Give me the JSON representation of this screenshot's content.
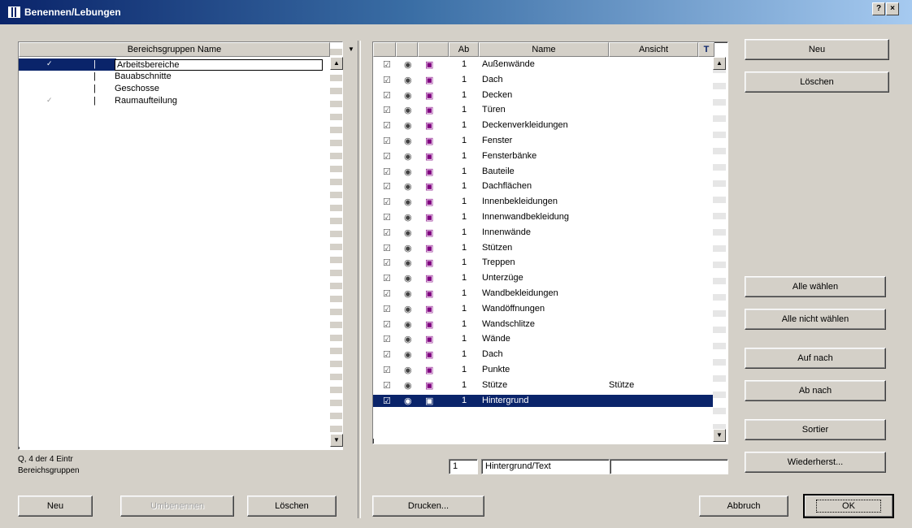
{
  "window": {
    "title": "Benennen/Lebungen",
    "close_glyph": "×",
    "help_glyph": "?"
  },
  "left_panel": {
    "column_header": "Bereichsgruppen Name",
    "rows": [
      {
        "mark": "✓",
        "sep": "|",
        "name": "Arbeitsbereiche"
      },
      {
        "mark": "",
        "sep": "|",
        "name": "Bauabschnitte"
      },
      {
        "mark": "",
        "sep": "|",
        "name": "Geschosse"
      },
      {
        "mark": "✓",
        "sep": "|",
        "name": "Raumaufteilung"
      }
    ],
    "status_line1": "Q, 4 der 4 Eintr",
    "status_line2": "Bereichsgruppen"
  },
  "middle_panel": {
    "headers": [
      "",
      "",
      "",
      "Ab",
      "Name",
      "Ansicht",
      "T"
    ],
    "rows": [
      {
        "c1": "☑",
        "c2": "◉",
        "c3": "▣",
        "count": "1",
        "name": "Außenwände",
        "extra": ""
      },
      {
        "c1": "☑",
        "c2": "◉",
        "c3": "▣",
        "count": "1",
        "name": "Dach",
        "extra": ""
      },
      {
        "c1": "☑",
        "c2": "◉",
        "c3": "▣",
        "count": "1",
        "name": "Decken",
        "extra": ""
      },
      {
        "c1": "☑",
        "c2": "◉",
        "c3": "▣",
        "count": "1",
        "name": "Türen",
        "extra": ""
      },
      {
        "c1": "☑",
        "c2": "◉",
        "c3": "▣",
        "count": "1",
        "name": "Deckenverkleidungen",
        "extra": ""
      },
      {
        "c1": "☑",
        "c2": "◉",
        "c3": "▣",
        "count": "1",
        "name": "Fenster",
        "extra": ""
      },
      {
        "c1": "☑",
        "c2": "◉",
        "c3": "▣",
        "count": "1",
        "name": "Fensterbänke",
        "extra": ""
      },
      {
        "c1": "☑",
        "c2": "◉",
        "c3": "▣",
        "count": "1",
        "name": "Bauteile",
        "extra": ""
      },
      {
        "c1": "☑",
        "c2": "◉",
        "c3": "▣",
        "count": "1",
        "name": "Dachflächen",
        "extra": ""
      },
      {
        "c1": "☑",
        "c2": "◉",
        "c3": "▣",
        "count": "1",
        "name": "Innenbekleidungen",
        "extra": ""
      },
      {
        "c1": "☑",
        "c2": "◉",
        "c3": "▣",
        "count": "1",
        "name": "Innenwandbekleidung",
        "extra": ""
      },
      {
        "c1": "☑",
        "c2": "◉",
        "c3": "▣",
        "count": "1",
        "name": "Innenwände",
        "extra": ""
      },
      {
        "c1": "☑",
        "c2": "◉",
        "c3": "▣",
        "count": "1",
        "name": "Stützen",
        "extra": ""
      },
      {
        "c1": "☑",
        "c2": "◉",
        "c3": "▣",
        "count": "1",
        "name": "Treppen",
        "extra": ""
      },
      {
        "c1": "☑",
        "c2": "◉",
        "c3": "▣",
        "count": "1",
        "name": "Unterzüge",
        "extra": ""
      },
      {
        "c1": "☑",
        "c2": "◉",
        "c3": "▣",
        "count": "1",
        "name": "Wandbekleidungen",
        "extra": ""
      },
      {
        "c1": "☑",
        "c2": "◉",
        "c3": "▣",
        "count": "1",
        "name": "Wandöffnungen",
        "extra": ""
      },
      {
        "c1": "☑",
        "c2": "◉",
        "c3": "▣",
        "count": "1",
        "name": "Wandschlitze",
        "extra": ""
      },
      {
        "c1": "☑",
        "c2": "◉",
        "c3": "▣",
        "count": "1",
        "name": "Wände",
        "extra": ""
      },
      {
        "c1": "☑",
        "c2": "◉",
        "c3": "▣",
        "count": "1",
        "name": "Dach",
        "extra": ""
      },
      {
        "c1": "☑",
        "c2": "◉",
        "c3": "▣",
        "count": "1",
        "name": "Punkte",
        "extra": ""
      },
      {
        "c1": "☑",
        "c2": "◉",
        "c3": "▣",
        "count": "1",
        "name": "Stütze",
        "extra": "Stütze"
      },
      {
        "c1": "☑",
        "c2": "◉",
        "c3": "▣",
        "count": "1",
        "name": "Hintergrund",
        "extra": ""
      }
    ],
    "edit_number": "1",
    "edit_name": "Hintergrund/Text",
    "edit_extra": ""
  },
  "right_buttons": {
    "new": "Neu",
    "delete": "Löschen",
    "select_all": "Alle wählen",
    "deselect_all": "Alle nicht wählen",
    "move_up": "Auf nach",
    "move_down": "Ab nach",
    "sort": "Sortier",
    "restore": "Wiederherst..."
  },
  "bottom_buttons": {
    "new": "Neu",
    "rename": "Umbenennen",
    "delete": "Löschen",
    "print": "Drucken...",
    "cancel": "Abbruch",
    "ok": "OK"
  }
}
